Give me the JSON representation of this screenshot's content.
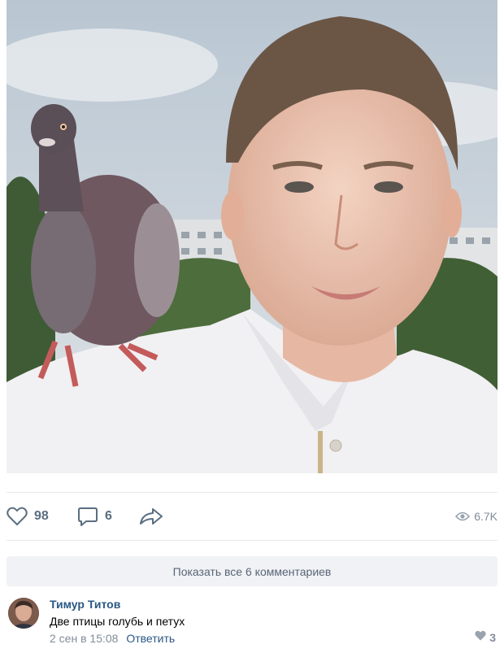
{
  "post": {
    "photo_icon": "selfie-photo"
  },
  "actions": {
    "likes": "98",
    "comments": "6",
    "views": "6.7K",
    "like_icon": "heart-icon",
    "comment_icon": "comment-bubble-icon",
    "share_icon": "share-arrow-icon",
    "views_icon": "eye-icon"
  },
  "comments_section": {
    "show_all_label": "Показать все 6 комментариев"
  },
  "comment": {
    "author": "Тимур Титов",
    "text": "Две птицы голубь и петух",
    "time": "2 сен в 15:08",
    "reply_label": "Ответить",
    "likes": "3"
  },
  "colors": {
    "link": "#2a5885",
    "muted": "#818c99",
    "action": "#5a6e80",
    "button_bg": "#f0f2f5"
  }
}
